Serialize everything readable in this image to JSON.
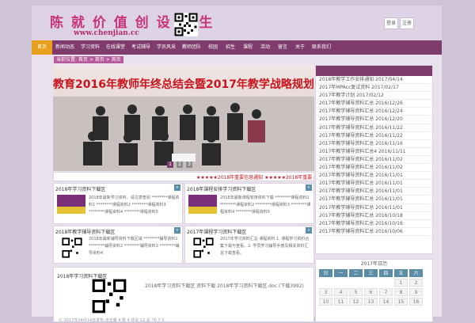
{
  "header": {
    "logo_text": "陈 就 价 值  创 设 人 生",
    "logo_url": "www.chenjian.cc",
    "button_1": "登录",
    "button_2": "注册"
  },
  "nav": {
    "items": [
      {
        "label": "首页",
        "active": true
      },
      {
        "label": "新闻动态",
        "active": false
      },
      {
        "label": "学习资料",
        "active": false
      },
      {
        "label": "在线课堂",
        "active": false
      },
      {
        "label": "考试辅导",
        "active": false
      },
      {
        "label": "学员风采",
        "active": false
      },
      {
        "label": "教师团队",
        "active": false
      },
      {
        "label": "校园",
        "active": false
      },
      {
        "label": "招生",
        "active": false
      },
      {
        "label": "课程",
        "active": false
      },
      {
        "label": "活动",
        "active": false
      },
      {
        "label": "留言",
        "active": false
      },
      {
        "label": "关于",
        "active": false
      },
      {
        "label": "联系我们",
        "active": false
      }
    ]
  },
  "breadcrumb": "当前位置: 首页 > 首页 > 首页",
  "slider": {
    "banner_text": "教育2016年教师年终总结会暨2017年教学战略规划会",
    "dots": [
      "1",
      "2",
      "3"
    ],
    "ticker": "★★★★★2018年重要信息通知 ★★★★★2018年重要"
  },
  "boxes": [
    {
      "title": "2018年学习资料下载区",
      "text": "2018年最新学习资料，请注意查阅 ********课程资料1 ********课程资料2 ********课程资料3 ********课程资料4 ********课程资料5"
    },
    {
      "title": "2018年课程安排学习资料下载区",
      "text": "2018年最新课程安排资料下载 ********课程资料1 ********课程资料2 ********课程资料3 ********课程资料4 ********课程资料5"
    },
    {
      "title": "2018年教学辅导资料下载区",
      "text": "2018年最新辅导资料下载区域 ********辅导资料1 ********辅导资料2 ********辅导资料3 ********辅导资料4"
    },
    {
      "title": "2017年课程学习资料下载区",
      "text": "2017年学习资料汇总 课程资料 1. 课程学习资料合集下载与查看。2. 学员学习辅导手册及相关资料汇总下载查看。"
    }
  ],
  "sidebar": {
    "items": [
      "2018年教学工作安排通知 2017/04/14",
      "2017年MPAcc复试资料 2017/02/17",
      "2017年教学计划 2017/02/12",
      "2017年教学辅导资料汇总 2016/12/26",
      "2017年教学辅导资料汇总 2016/12/24",
      "2017年教学辅导资料汇总 2016/12/20",
      "2017年教学辅导资料汇总 2016/11/22",
      "2017年教学辅导资料汇总 2016/11/22",
      "2017年教学辅导资料汇总 2016/11/16",
      "2017年教学辅导资料汇总4 2016/11/11",
      "2017年教学辅导资料汇总 2016/11/02",
      "2017年教学辅导资料汇总 2016/11/02",
      "2017年教学辅导资料汇总 2016/11/01",
      "2017年教学辅导资料汇总 2016/11/01",
      "2017年教学辅导资料汇总 2016/11/01",
      "2017年教学辅导资料汇总 2016/11/01",
      "2017年教学辅导资料汇总 2016/11/01",
      "2017年教学辅导资料汇总 2016/10/18",
      "2017年教学辅导资料汇总 2016/10/16",
      "2017年教学辅导资料汇总 2016/10/06"
    ]
  },
  "calendar": {
    "title": "2017年日历",
    "weekdays": [
      "日",
      "一",
      "二",
      "三",
      "四",
      "五",
      "六"
    ],
    "days": [
      "",
      "",
      "",
      "",
      "",
      "1",
      "2",
      "3",
      "4",
      "5",
      "6",
      "7",
      "8",
      "9",
      "10",
      "11",
      "12",
      "13",
      "14",
      "15",
      "16"
    ]
  },
  "article": {
    "title": "2018年学习资料下载区",
    "text": "2018年学习资料下载区 资料下载 2018年学习资料下载区.doc (下载3992)",
    "footer": "© 2017年04月14日发布 点击量 4 赞 4 评论 12 总 76 7 0"
  },
  "colors": {
    "nav": "#7e3c6c",
    "nav_active": "#e8a01c",
    "accent_blue": "#5b8ea6",
    "logo": "#c8327b"
  }
}
